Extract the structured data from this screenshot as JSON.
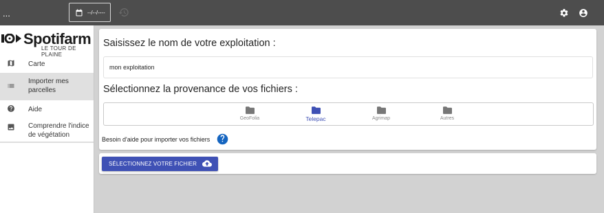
{
  "topbar": {
    "menu_label": "...",
    "date_value": "--/--/----",
    "icons": [
      "calendar-icon",
      "history-icon",
      "settings-icon",
      "account-icon"
    ]
  },
  "logo": {
    "name": "Spotifarm",
    "tagline": "LE TOUR DE PLAINE"
  },
  "sidebar": {
    "items": [
      {
        "label": "Carte",
        "icon": "map-icon"
      },
      {
        "label": "Importer mes parcelles",
        "icon": "list-icon",
        "active": true
      },
      {
        "label": "Aide",
        "icon": "help-circle-icon"
      },
      {
        "label": "Comprendre l'indice de végétation",
        "icon": "image-icon"
      }
    ]
  },
  "main": {
    "name_heading": "Saisissez le nom de votre exploitation :",
    "name_value": "mon exploitation",
    "source_heading": "Sélectionnez la provenance de vos fichiers :",
    "sources": [
      {
        "label": "GeoFolia",
        "icon": "folder-icon",
        "selected": false
      },
      {
        "label": "Telepac",
        "icon": "folder-icon",
        "selected": true
      },
      {
        "label": "Agrimap",
        "icon": "folder-icon",
        "selected": false
      },
      {
        "label": "Autres",
        "icon": "folder-icon",
        "selected": false
      }
    ],
    "help_text": "Besoin d'aide pour importer vos fichiers"
  },
  "upload": {
    "button_label": "SÉLECTIONNEZ VOTRE FICHIER",
    "icon": "cloud-upload-icon"
  },
  "colors": {
    "topbar": "#4d4d4d",
    "accent": "#3f51b5",
    "help_icon": "#1565c0",
    "background": "#d2d2d2"
  }
}
